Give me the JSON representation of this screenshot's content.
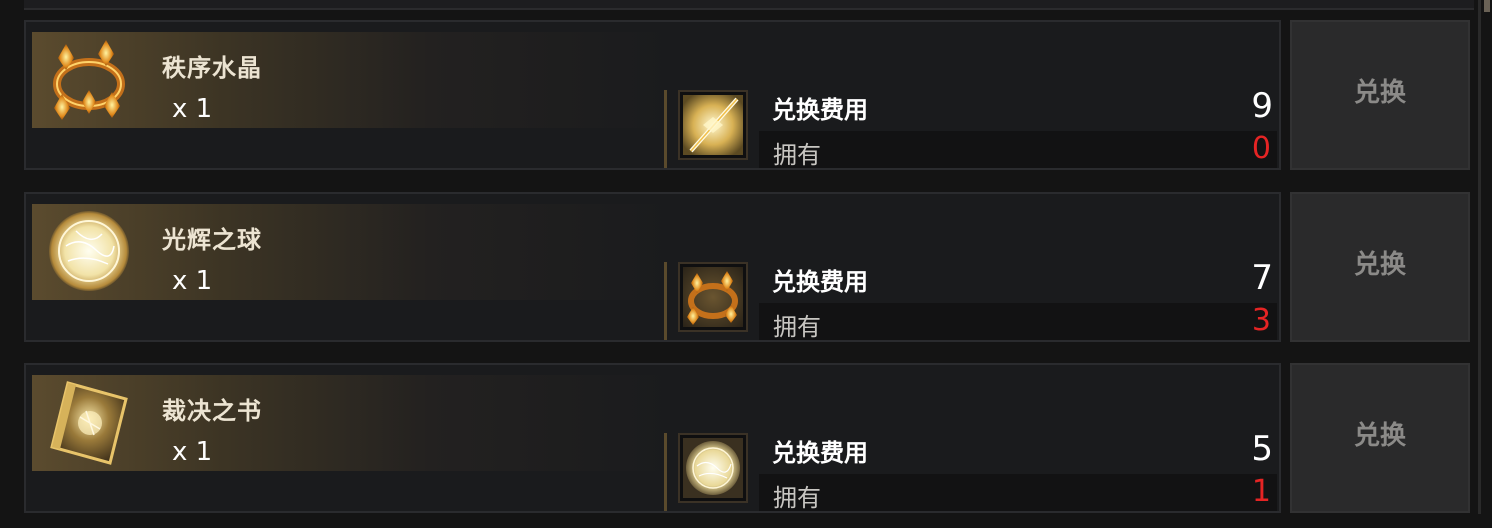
{
  "cost_label": "兑换费用",
  "owned_label": "拥有",
  "exchange_label": "兑换",
  "items": [
    {
      "name": "秩序水晶",
      "qty": "x 1",
      "icon": "golden-crown-icon",
      "cost": "9",
      "owned": "0",
      "cost_icon": "light-spear-icon"
    },
    {
      "name": "光辉之球",
      "qty": "x 1",
      "icon": "radiant-orb-icon",
      "cost": "7",
      "owned": "3",
      "cost_icon": "golden-crown-icon"
    },
    {
      "name": "裁决之书",
      "qty": "x 1",
      "icon": "judgment-book-icon",
      "cost": "5",
      "owned": "1",
      "cost_icon": "radiant-orb-icon"
    }
  ],
  "colors": {
    "owned_value": "#e52424",
    "accent_gold": "#d9a441",
    "button_text": "#8b8a88"
  }
}
